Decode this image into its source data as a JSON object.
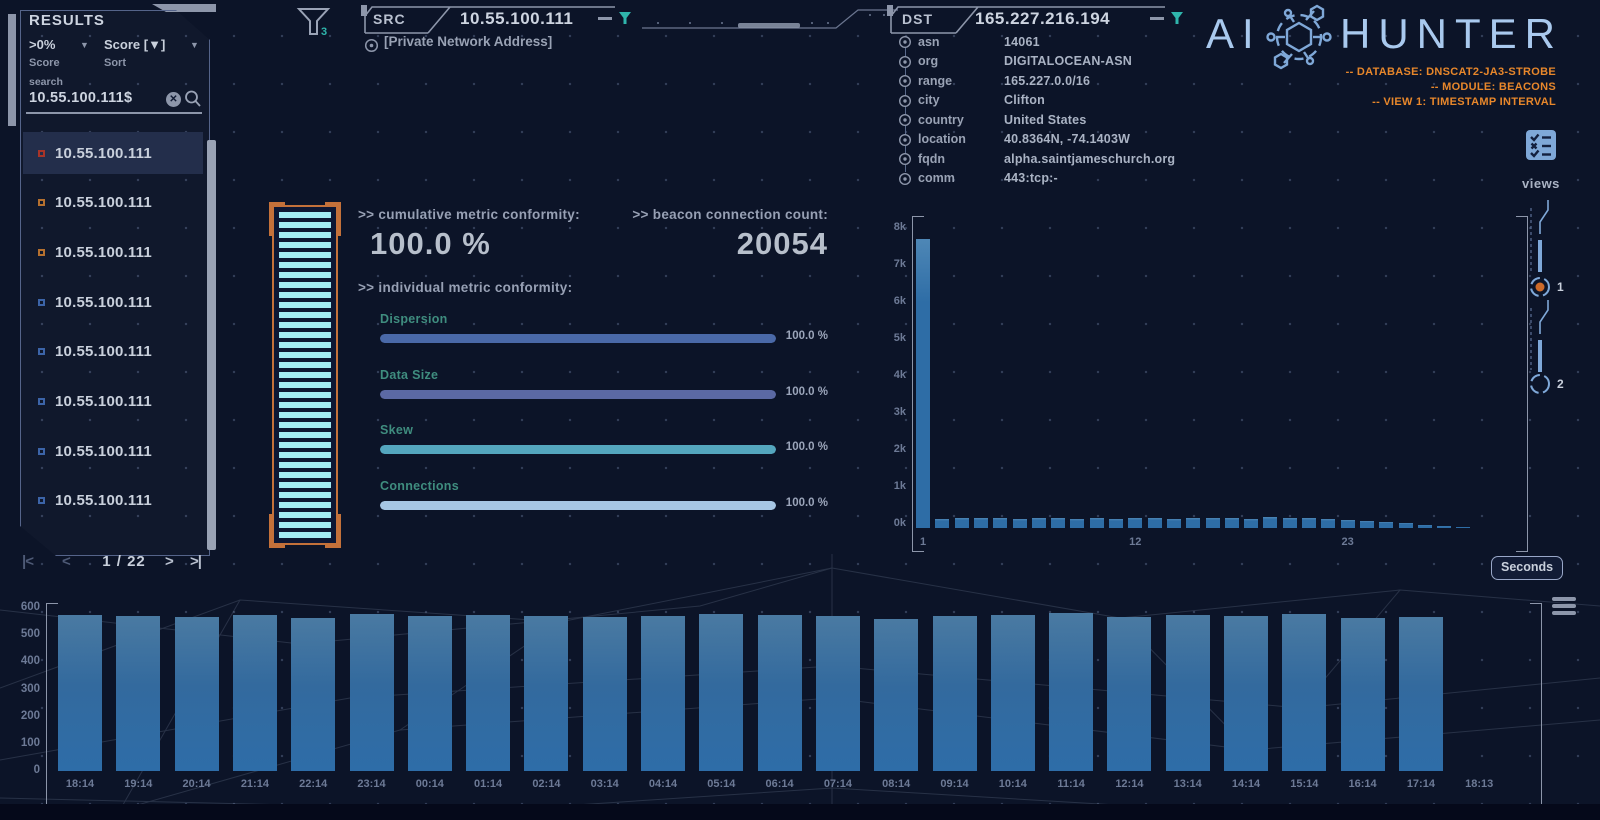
{
  "app": {
    "logo_left": "AI",
    "logo_right": "HUNTER",
    "status_lines": [
      "-- DATABASE: DNSCAT2-JA3-STROBE",
      "-- MODULE: BEACONS",
      "-- VIEW 1: TIMESTAMP INTERVAL"
    ]
  },
  "icons": {
    "dropdown_caret": "▼",
    "page_first": "|<",
    "page_prev": "<",
    "page_next": ">",
    "page_last": ">|",
    "clear_glyph": "✕"
  },
  "results": {
    "title": "RESULTS",
    "score_filter": {
      "value": ">0%",
      "label": "Score"
    },
    "sort_filter": {
      "value": "Score [▼]",
      "label": "Sort"
    },
    "search_label": "search",
    "search_value": "10.55.100.111$",
    "items": [
      {
        "label": "10.55.100.111",
        "bullet": "#a83428",
        "selected": true
      },
      {
        "label": "10.55.100.111",
        "bullet": "#b5702f",
        "selected": false
      },
      {
        "label": "10.55.100.111",
        "bullet": "#b5702f",
        "selected": false
      },
      {
        "label": "10.55.100.111",
        "bullet": "#3c64a8",
        "selected": false
      },
      {
        "label": "10.55.100.111",
        "bullet": "#3c64a8",
        "selected": false
      },
      {
        "label": "10.55.100.111",
        "bullet": "#3c64a8",
        "selected": false
      },
      {
        "label": "10.55.100.111",
        "bullet": "#3c64a8",
        "selected": false
      },
      {
        "label": "10.55.100.111",
        "bullet": "#3c64a8",
        "selected": false
      }
    ],
    "pagination": {
      "page_label": "1 / 22"
    }
  },
  "src": {
    "label": "SRC",
    "value": "10.55.100.111",
    "note": "[Private Network Address]",
    "filter_count": "3"
  },
  "dst": {
    "label": "DST",
    "value": "165.227.216.194",
    "rows": [
      {
        "key": "asn",
        "value": "14061"
      },
      {
        "key": "org",
        "value": "DIGITALOCEAN-ASN"
      },
      {
        "key": "range",
        "value": "165.227.0.0/16"
      },
      {
        "key": "city",
        "value": "Clifton"
      },
      {
        "key": "country",
        "value": "United States"
      },
      {
        "key": "location",
        "value": "40.8364N, -74.1403W"
      },
      {
        "key": "fqdn",
        "value": "alpha.saintjameschurch.org"
      },
      {
        "key": "comm",
        "value": "443:tcp:-"
      }
    ]
  },
  "metrics": {
    "cumulative_label": ">> cumulative metric conformity:",
    "cumulative_value": "100.0 %",
    "count_label": ">> beacon connection count:",
    "count_value": "20054",
    "individual_label": ">> individual metric conformity:",
    "bars": [
      {
        "label": "Dispersion",
        "value": "100.0 %",
        "percent": 100,
        "color": "#4a69a8"
      },
      {
        "label": "Data Size",
        "value": "100.0 %",
        "percent": 100,
        "color": "#5b69a4"
      },
      {
        "label": "Skew",
        "value": "100.0 %",
        "percent": 100,
        "color": "#54a6be"
      },
      {
        "label": "Connections",
        "value": "100.0 %",
        "percent": 100,
        "color": "#a6c6e4"
      }
    ]
  },
  "views": {
    "label": "views",
    "markers": [
      "1",
      "2"
    ]
  },
  "controls": {
    "seconds_button": "Seconds"
  },
  "chart_data": [
    {
      "name": "beacon-interval-histogram",
      "type": "bar",
      "x": [
        1,
        2,
        3,
        4,
        5,
        6,
        7,
        8,
        9,
        10,
        11,
        12,
        13,
        14,
        15,
        16,
        17,
        18,
        19,
        20,
        21,
        22,
        23,
        24,
        25,
        26,
        27,
        28,
        29
      ],
      "values": [
        7800,
        255,
        270,
        265,
        258,
        252,
        260,
        268,
        252,
        262,
        255,
        258,
        268,
        252,
        262,
        275,
        262,
        252,
        298,
        282,
        260,
        240,
        218,
        198,
        172,
        130,
        88,
        55,
        32
      ],
      "xticks": [
        "1",
        "12",
        "23"
      ],
      "yticks": [
        "8k",
        "7k",
        "6k",
        "5k",
        "4k",
        "3k",
        "2k",
        "1k",
        "0k"
      ],
      "ylim": [
        0,
        8000
      ],
      "bar_color": "#2e6da6",
      "legend": "none",
      "grid": "dotted-background"
    },
    {
      "name": "timestamp-interval-histogram",
      "type": "bar",
      "categories": [
        "18:14",
        "19:14",
        "20:14",
        "21:14",
        "22:14",
        "23:14",
        "00:14",
        "01:14",
        "02:14",
        "03:14",
        "04:14",
        "05:14",
        "06:14",
        "07:14",
        "08:14",
        "09:14",
        "10:14",
        "11:14",
        "12:14",
        "13:14",
        "14:14",
        "15:14",
        "16:14",
        "17:14",
        "18:13"
      ],
      "values": [
        574,
        570,
        566,
        576,
        562,
        578,
        571,
        574,
        569,
        566,
        572,
        579,
        575,
        570,
        561,
        571,
        575,
        580,
        567,
        576,
        572,
        577,
        565,
        568,
        0
      ],
      "yticks": [
        "600",
        "500",
        "400",
        "300",
        "200",
        "100",
        "0"
      ],
      "ylim": [
        0,
        600
      ],
      "bar_color": "#2e6da8",
      "units_toggle": "Seconds",
      "legend": "none",
      "grid": "mesh-background"
    }
  ]
}
